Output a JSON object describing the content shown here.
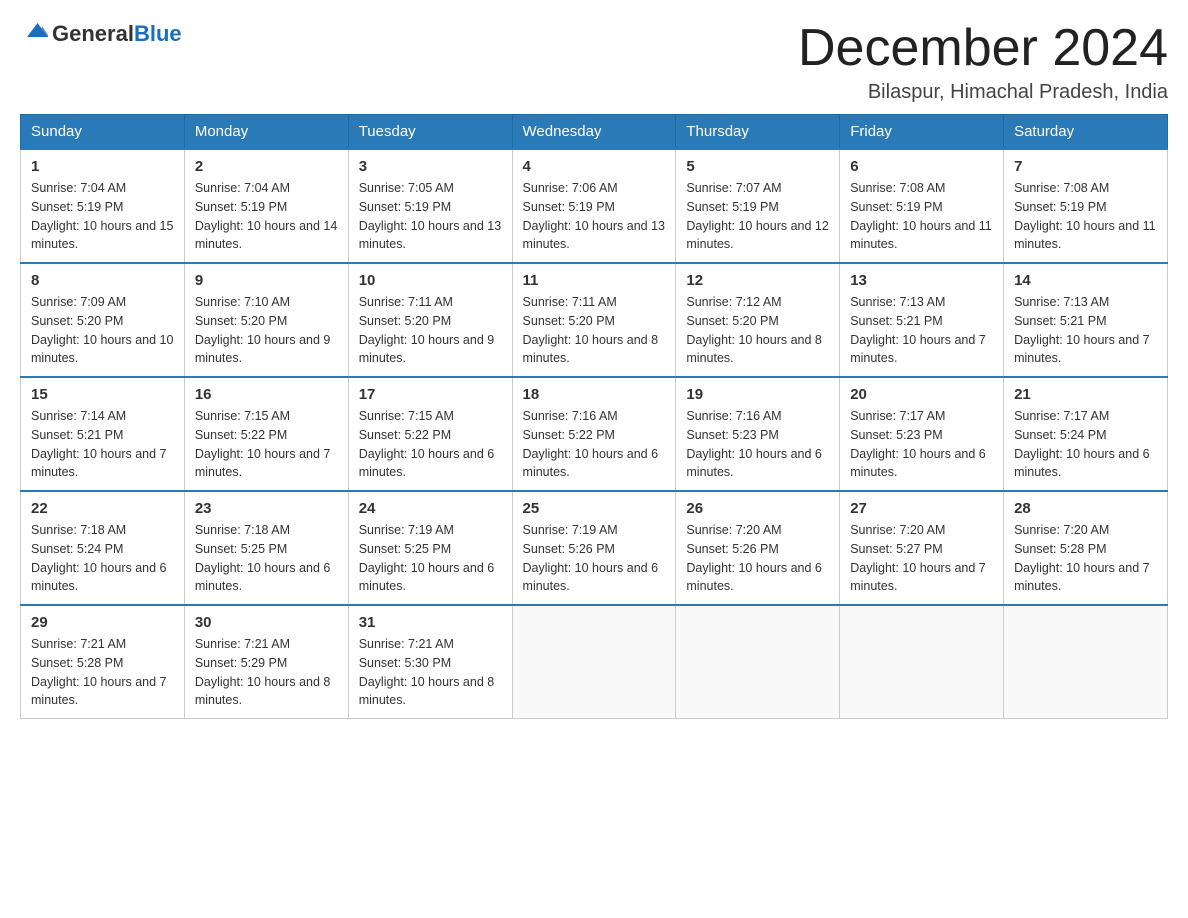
{
  "header": {
    "logo_general": "General",
    "logo_blue": "Blue",
    "title": "December 2024",
    "subtitle": "Bilaspur, Himachal Pradesh, India"
  },
  "weekdays": [
    "Sunday",
    "Monday",
    "Tuesday",
    "Wednesday",
    "Thursday",
    "Friday",
    "Saturday"
  ],
  "weeks": [
    [
      {
        "day": "1",
        "sunrise": "7:04 AM",
        "sunset": "5:19 PM",
        "daylight": "10 hours and 15 minutes."
      },
      {
        "day": "2",
        "sunrise": "7:04 AM",
        "sunset": "5:19 PM",
        "daylight": "10 hours and 14 minutes."
      },
      {
        "day": "3",
        "sunrise": "7:05 AM",
        "sunset": "5:19 PM",
        "daylight": "10 hours and 13 minutes."
      },
      {
        "day": "4",
        "sunrise": "7:06 AM",
        "sunset": "5:19 PM",
        "daylight": "10 hours and 13 minutes."
      },
      {
        "day": "5",
        "sunrise": "7:07 AM",
        "sunset": "5:19 PM",
        "daylight": "10 hours and 12 minutes."
      },
      {
        "day": "6",
        "sunrise": "7:08 AM",
        "sunset": "5:19 PM",
        "daylight": "10 hours and 11 minutes."
      },
      {
        "day": "7",
        "sunrise": "7:08 AM",
        "sunset": "5:19 PM",
        "daylight": "10 hours and 11 minutes."
      }
    ],
    [
      {
        "day": "8",
        "sunrise": "7:09 AM",
        "sunset": "5:20 PM",
        "daylight": "10 hours and 10 minutes."
      },
      {
        "day": "9",
        "sunrise": "7:10 AM",
        "sunset": "5:20 PM",
        "daylight": "10 hours and 9 minutes."
      },
      {
        "day": "10",
        "sunrise": "7:11 AM",
        "sunset": "5:20 PM",
        "daylight": "10 hours and 9 minutes."
      },
      {
        "day": "11",
        "sunrise": "7:11 AM",
        "sunset": "5:20 PM",
        "daylight": "10 hours and 8 minutes."
      },
      {
        "day": "12",
        "sunrise": "7:12 AM",
        "sunset": "5:20 PM",
        "daylight": "10 hours and 8 minutes."
      },
      {
        "day": "13",
        "sunrise": "7:13 AM",
        "sunset": "5:21 PM",
        "daylight": "10 hours and 7 minutes."
      },
      {
        "day": "14",
        "sunrise": "7:13 AM",
        "sunset": "5:21 PM",
        "daylight": "10 hours and 7 minutes."
      }
    ],
    [
      {
        "day": "15",
        "sunrise": "7:14 AM",
        "sunset": "5:21 PM",
        "daylight": "10 hours and 7 minutes."
      },
      {
        "day": "16",
        "sunrise": "7:15 AM",
        "sunset": "5:22 PM",
        "daylight": "10 hours and 7 minutes."
      },
      {
        "day": "17",
        "sunrise": "7:15 AM",
        "sunset": "5:22 PM",
        "daylight": "10 hours and 6 minutes."
      },
      {
        "day": "18",
        "sunrise": "7:16 AM",
        "sunset": "5:22 PM",
        "daylight": "10 hours and 6 minutes."
      },
      {
        "day": "19",
        "sunrise": "7:16 AM",
        "sunset": "5:23 PM",
        "daylight": "10 hours and 6 minutes."
      },
      {
        "day": "20",
        "sunrise": "7:17 AM",
        "sunset": "5:23 PM",
        "daylight": "10 hours and 6 minutes."
      },
      {
        "day": "21",
        "sunrise": "7:17 AM",
        "sunset": "5:24 PM",
        "daylight": "10 hours and 6 minutes."
      }
    ],
    [
      {
        "day": "22",
        "sunrise": "7:18 AM",
        "sunset": "5:24 PM",
        "daylight": "10 hours and 6 minutes."
      },
      {
        "day": "23",
        "sunrise": "7:18 AM",
        "sunset": "5:25 PM",
        "daylight": "10 hours and 6 minutes."
      },
      {
        "day": "24",
        "sunrise": "7:19 AM",
        "sunset": "5:25 PM",
        "daylight": "10 hours and 6 minutes."
      },
      {
        "day": "25",
        "sunrise": "7:19 AM",
        "sunset": "5:26 PM",
        "daylight": "10 hours and 6 minutes."
      },
      {
        "day": "26",
        "sunrise": "7:20 AM",
        "sunset": "5:26 PM",
        "daylight": "10 hours and 6 minutes."
      },
      {
        "day": "27",
        "sunrise": "7:20 AM",
        "sunset": "5:27 PM",
        "daylight": "10 hours and 7 minutes."
      },
      {
        "day": "28",
        "sunrise": "7:20 AM",
        "sunset": "5:28 PM",
        "daylight": "10 hours and 7 minutes."
      }
    ],
    [
      {
        "day": "29",
        "sunrise": "7:21 AM",
        "sunset": "5:28 PM",
        "daylight": "10 hours and 7 minutes."
      },
      {
        "day": "30",
        "sunrise": "7:21 AM",
        "sunset": "5:29 PM",
        "daylight": "10 hours and 8 minutes."
      },
      {
        "day": "31",
        "sunrise": "7:21 AM",
        "sunset": "5:30 PM",
        "daylight": "10 hours and 8 minutes."
      },
      null,
      null,
      null,
      null
    ]
  ]
}
